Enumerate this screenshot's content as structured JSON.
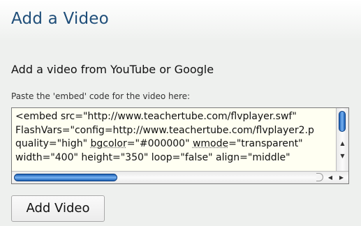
{
  "header": {
    "title": "Add a Video"
  },
  "form": {
    "subtitle": "Add a video from YouTube or Google",
    "field_label": "Paste the 'embed' code for the video here:",
    "embed_lines": [
      [
        "<embed src=\"http://www.teachertube.com/flvplayer.swf\""
      ],
      [
        "FlashVars=\"config=http://www.teachertube.com/flvplayer2.p"
      ],
      [
        "quality=\"high\" ",
        "bgcolor",
        "=\"#000000\" ",
        "wmode",
        "=\"transparent\""
      ],
      [
        "width=\"400\" height=\"350\" loop=\"false\" align=\"middle\""
      ]
    ],
    "submit_label": "Add Video"
  },
  "scrollbars": {
    "vertical_position": 0,
    "horizontal_position": 0,
    "thumb_color": "#1a5fb4"
  },
  "icons": {
    "scroll_up": "arrow-up-icon",
    "scroll_down": "arrow-down-icon",
    "scroll_left": "arrow-left-icon",
    "scroll_right": "arrow-right-icon"
  },
  "colors": {
    "title": "#1f4e79",
    "textarea_background": "#fffff2",
    "panel_background": "#eef0ee"
  }
}
